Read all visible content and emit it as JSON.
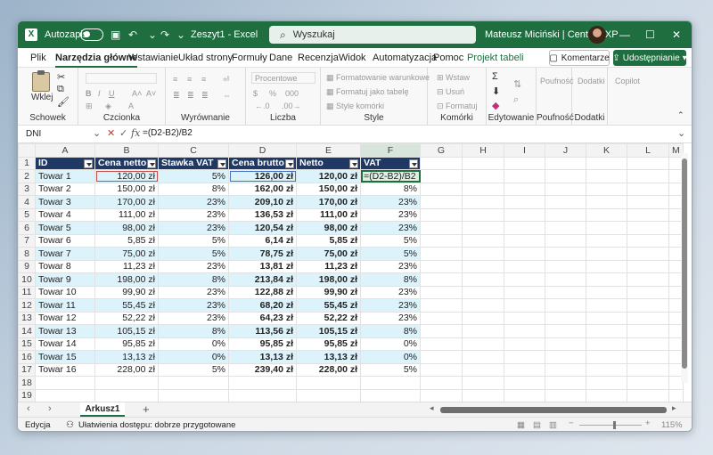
{
  "titlebar": {
    "logo": "X",
    "autosave_label": "Autozapis",
    "doc_title": "Zeszyt1 - Excel",
    "search_placeholder": "Wyszukaj",
    "user_name": "Mateusz Miciński | CentrumXP",
    "minimize": "—",
    "maximize": "☐",
    "close": "✕"
  },
  "tabs": [
    "Plik",
    "Narzędzia główne",
    "Wstawianie",
    "Układ strony",
    "Formuły",
    "Dane",
    "Recenzja",
    "Widok",
    "Automatyzacja",
    "Pomoc",
    "Projekt tabeli"
  ],
  "tab_active_index": 1,
  "ribbon": {
    "komentarze": "Komentarze",
    "udostepnianie": "Udostępnianie",
    "paste_label": "Wklej",
    "groups": {
      "schowek": "Schowek",
      "czcionka": "Czcionka",
      "wyrownanie": "Wyrównanie",
      "liczba": "Liczba",
      "style": "Style",
      "komorki": "Komórki",
      "edytowanie": "Edytowanie",
      "poufnosc": "Poufność",
      "dodatki": "Dodatki"
    },
    "number_format": "Procentowe",
    "style_items": [
      "Formatowanie warunkowe",
      "Formatuj jako tabelę",
      "Style komórki"
    ],
    "cells_items": [
      "Wstaw",
      "Usuń",
      "Formatuj"
    ],
    "poufnosc_btn": "Poufność",
    "dodatki_btn": "Dodatki",
    "copilot_btn": "Copilot"
  },
  "formula_bar": {
    "name_box": "DNI",
    "formula": "=(D2-B2)/B2"
  },
  "columns": [
    "A",
    "B",
    "C",
    "D",
    "E",
    "F",
    "G",
    "H",
    "I",
    "J",
    "K",
    "L",
    "M"
  ],
  "table_headers": [
    "ID",
    "Cena netto",
    "Stawka VAT",
    "Cena brutto",
    "Netto",
    "VAT"
  ],
  "rows": [
    [
      "Towar 1",
      "120,00 zł",
      "5%",
      "126,00 zł",
      "120,00 zł",
      "=(D2-B2)/B2"
    ],
    [
      "Towar 2",
      "150,00 zł",
      "8%",
      "162,00 zł",
      "150,00 zł",
      "8%"
    ],
    [
      "Towar 3",
      "170,00 zł",
      "23%",
      "209,10 zł",
      "170,00 zł",
      "23%"
    ],
    [
      "Towar 4",
      "111,00 zł",
      "23%",
      "136,53 zł",
      "111,00 zł",
      "23%"
    ],
    [
      "Towar 5",
      "98,00 zł",
      "23%",
      "120,54 zł",
      "98,00 zł",
      "23%"
    ],
    [
      "Towar 6",
      "5,85 zł",
      "5%",
      "6,14 zł",
      "5,85 zł",
      "5%"
    ],
    [
      "Towar 7",
      "75,00 zł",
      "5%",
      "78,75 zł",
      "75,00 zł",
      "5%"
    ],
    [
      "Towar 8",
      "11,23 zł",
      "23%",
      "13,81 zł",
      "11,23 zł",
      "23%"
    ],
    [
      "Towar 9",
      "198,00 zł",
      "8%",
      "213,84 zł",
      "198,00 zł",
      "8%"
    ],
    [
      "Towar 10",
      "99,90 zł",
      "23%",
      "122,88 zł",
      "99,90 zł",
      "23%"
    ],
    [
      "Towar 11",
      "55,45 zł",
      "23%",
      "68,20 zł",
      "55,45 zł",
      "23%"
    ],
    [
      "Towar 12",
      "52,22 zł",
      "23%",
      "64,23 zł",
      "52,22 zł",
      "23%"
    ],
    [
      "Towar 13",
      "105,15 zł",
      "8%",
      "113,56 zł",
      "105,15 zł",
      "8%"
    ],
    [
      "Towar 14",
      "95,85 zł",
      "0%",
      "95,85 zł",
      "95,85 zł",
      "0%"
    ],
    [
      "Towar 15",
      "13,13 zł",
      "0%",
      "13,13 zł",
      "13,13 zł",
      "0%"
    ],
    [
      "Towar 16",
      "228,00 zł",
      "5%",
      "239,40 zł",
      "228,00 zł",
      "5%"
    ]
  ],
  "row_numbers": [
    "1",
    "2",
    "3",
    "4",
    "5",
    "6",
    "7",
    "8",
    "9",
    "10",
    "11",
    "12",
    "13",
    "14",
    "15",
    "16",
    "17",
    "18",
    "19"
  ],
  "sheet": {
    "tab_name": "Arkusz1",
    "add": "+",
    "prev": "‹",
    "next": "›"
  },
  "status": {
    "mode": "Edycja",
    "accessibility": "Ułatwienia dostępu: dobrze przygotowane",
    "zoom": "115%"
  },
  "colors": {
    "accent": "#1e6e40",
    "table_header": "#203864",
    "band": "#ddf3fb"
  }
}
